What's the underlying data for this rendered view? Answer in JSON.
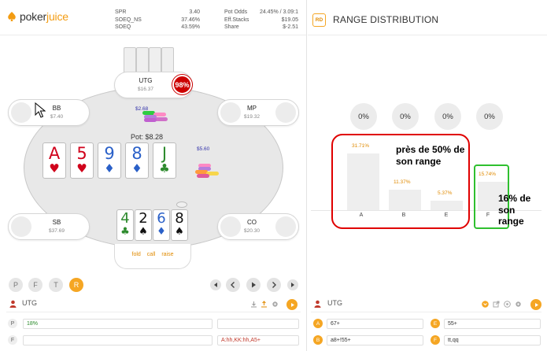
{
  "app": {
    "brand_prefix": "poker",
    "brand_suffix": "juice"
  },
  "header_stats": {
    "left": [
      {
        "label": "SPR",
        "value": "3.40"
      },
      {
        "label": "SOEQ_NS",
        "value": "37.46%"
      },
      {
        "label": "SOEQ",
        "value": "43.59%"
      }
    ],
    "right": [
      {
        "label": "Pot Odds",
        "value": "24.45% / 3.09:1"
      },
      {
        "label": "Eff.Stacks",
        "value": "$19.05"
      },
      {
        "label": "Share",
        "value": "$-2.51"
      }
    ]
  },
  "table": {
    "seats": {
      "utg": {
        "name": "UTG",
        "stack": "$16.37",
        "equity": "98%"
      },
      "bb": {
        "name": "BB",
        "stack": "$7.40"
      },
      "mp": {
        "name": "MP",
        "stack": "$19.32"
      },
      "sb": {
        "name": "SB",
        "stack": "$37.69"
      },
      "co": {
        "name": "CO",
        "stack": "$20.30"
      }
    },
    "bets": {
      "bb": "$2.68",
      "mp": "$5.60"
    },
    "pot": "Pot: $8.28",
    "board": [
      {
        "rank": "A",
        "suit": "♥",
        "color": "#d0021b"
      },
      {
        "rank": "5",
        "suit": "♥",
        "color": "#d0021b"
      },
      {
        "rank": "9",
        "suit": "♦",
        "color": "#2a60c8"
      },
      {
        "rank": "8",
        "suit": "♦",
        "color": "#2a60c8"
      },
      {
        "rank": "J",
        "suit": "♣",
        "color": "#2e8b2e"
      }
    ],
    "hero_cards": [
      {
        "rank": "4",
        "suit": "♣",
        "color": "#2e8b2e"
      },
      {
        "rank": "2",
        "suit": "♠",
        "color": "#111111"
      },
      {
        "rank": "6",
        "suit": "♦",
        "color": "#2a60c8"
      },
      {
        "rank": "8",
        "suit": "♠",
        "color": "#111111"
      }
    ],
    "actions": {
      "fold": "fold",
      "call": "call",
      "raise": "raise"
    }
  },
  "streets": [
    "P",
    "F",
    "T",
    "R"
  ],
  "active_street": "R",
  "left_panel": {
    "player": "UTG",
    "rows": [
      {
        "label": "P",
        "value1": "18%",
        "value2": ""
      },
      {
        "label": "F",
        "value1": "",
        "value2": "A:hh,KK:hh,A5+"
      }
    ]
  },
  "range_distribution": {
    "badge": "RD",
    "title": "RANGE DISTRIBUTION",
    "circles": [
      "0%",
      "0%",
      "0%",
      "0%"
    ],
    "bars": [
      {
        "category": "A",
        "pct_label": "31.71%",
        "value": 31.71
      },
      {
        "category": "B",
        "pct_label": "11.37%",
        "value": 11.37
      },
      {
        "category": "E",
        "pct_label": "5.37%",
        "value": 5.37
      },
      {
        "category": "F",
        "pct_label": "15.74%",
        "value": 15.74
      }
    ],
    "annotations": {
      "red": "près de 50% de son range",
      "green": "16% de son range"
    }
  },
  "right_panel": {
    "player": "UTG",
    "options": [
      {
        "badge": "A",
        "value": "67+"
      },
      {
        "badge": "E",
        "value": "55+"
      },
      {
        "badge": "B",
        "value": "a8+!55+"
      },
      {
        "badge": "F",
        "value": "tt,qq"
      }
    ]
  },
  "colors": {
    "accent": "#f5a623",
    "red_annotation": "#e00000",
    "green_annotation": "#2fc02f",
    "equity_badge": "#cc0000"
  }
}
